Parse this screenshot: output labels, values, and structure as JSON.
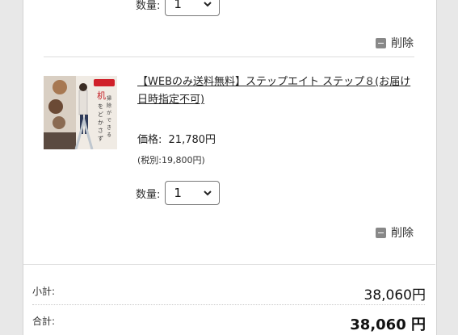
{
  "cart": {
    "item1": {
      "qty_label": "数量:",
      "qty_value": "1",
      "delete_label": "削除"
    },
    "item2": {
      "image_text": "机をどかさず掃除ができる",
      "name": "【WEBのみ送料無料】ステップエイト ステップ８(お届け日時指定不可)",
      "price_label": "価格:",
      "price_value": "21,780円",
      "tax_excluded": "(税別:19,800円)",
      "qty_label": "数量:",
      "qty_value": "1",
      "delete_label": "削除"
    }
  },
  "summary": {
    "subtotal_label": "小計:",
    "subtotal_value": "38,060円",
    "total_label": "合計:",
    "total_value": "38,060 円"
  },
  "colors": {
    "accent_red": "#d0202a",
    "icon_gray": "#888888"
  }
}
